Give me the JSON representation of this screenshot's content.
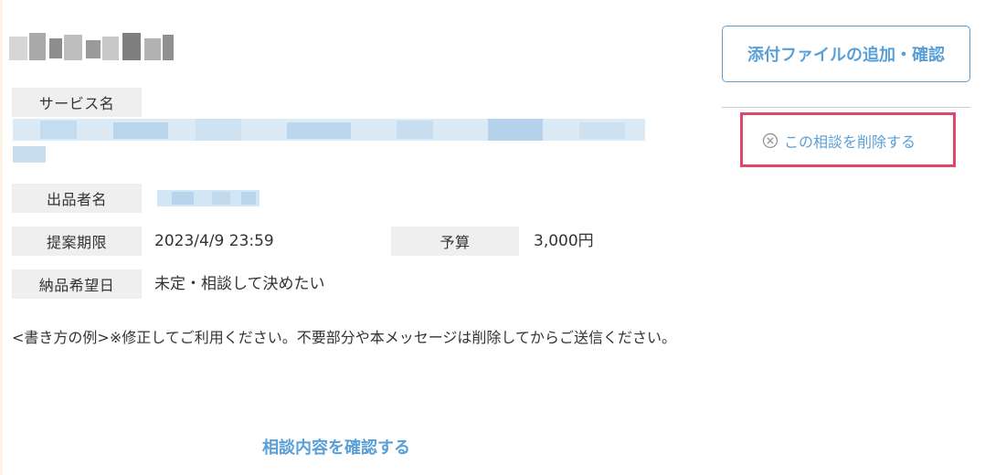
{
  "labels": {
    "service_name": "サービス名",
    "seller_name": "出品者名",
    "deadline": "提案期限",
    "budget": "予算",
    "delivery_date": "納品希望日"
  },
  "values": {
    "deadline": "2023/4/9 23:59",
    "budget": "3,000円",
    "delivery_date": "未定・相談して決めたい"
  },
  "note": "<書き方の例>※修正してご利用ください。不要部分や本メッセージは削除してからご送信ください。",
  "actions": {
    "attach_label": "添付ファイルの追加・確認",
    "delete_label": "この相談を削除する",
    "confirm_label": "相談内容を確認する"
  },
  "colors": {
    "accent": "#5aa0d8",
    "highlight_border": "#e2466a",
    "label_bg": "#efefef"
  }
}
